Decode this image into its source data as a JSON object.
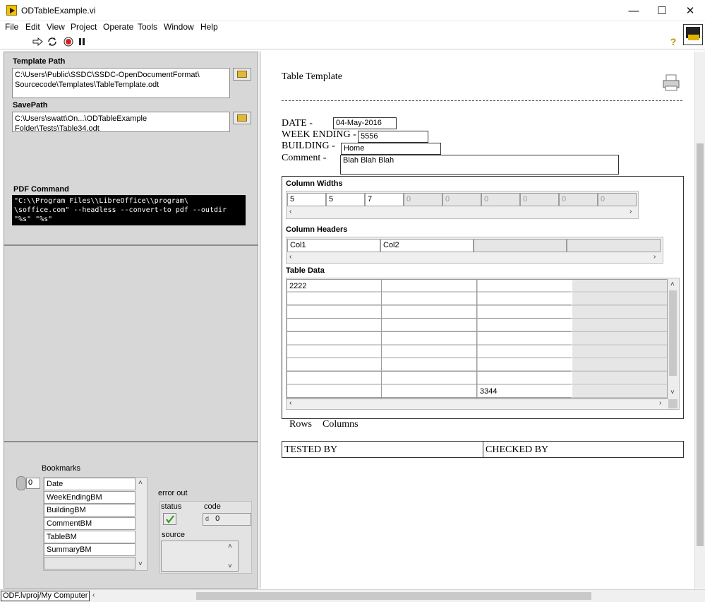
{
  "window": {
    "title": "ODTableExample.vi",
    "minimize": "—",
    "maximize": "☐",
    "close": "✕"
  },
  "menu": [
    "File",
    "Edit",
    "View",
    "Project",
    "Operate",
    "Tools",
    "Window",
    "Help"
  ],
  "toolbar": {
    "help_glyph": "?"
  },
  "left": {
    "template_path_label": "Template Path",
    "template_path_value": "C:\\Users\\Public\\SSDC\\SSDC-OpenDocumentFormat\\\nSourcecode\\Templates\\TableTemplate.odt",
    "save_path_label": "SavePath",
    "save_path_value": "C:\\Users\\swatt\\On...\\ODTableExample Folder\\Tests\\Table34.odt",
    "pdf_command_label": "PDF Command",
    "pdf_command_value": "\"C:\\\\Program Files\\\\LibreOffice\\\\program\\\n\\soffice.com\" --headless --convert-to pdf --outdir\n\"%s\" \"%s\"",
    "bookmarks_label": "Bookmarks",
    "bookmarks_index": "0",
    "bookmarks": [
      "Date",
      "WeekEndingBM",
      "BuildingBM",
      "CommentBM",
      "TableBM",
      "SummaryBM"
    ],
    "error_out_label": "error out",
    "status_label": "status",
    "code_label": "code",
    "code_value": "0",
    "code_prefix": "d",
    "source_label": "source"
  },
  "doc": {
    "heading": "Table Template",
    "date_label": "DATE  -",
    "date_value": "04-May-2016",
    "week_label": "WEEK ENDING -",
    "week_value": "5556",
    "building_label": "BUILDING -",
    "building_value": "Home",
    "comment_label": "Comment -",
    "comment_value": "Blah Blah Blah",
    "column_widths_label": "Column Widths",
    "column_widths": [
      "5",
      "5",
      "7",
      "0",
      "0",
      "0",
      "0",
      "0",
      "0"
    ],
    "column_headers_label": "Column Headers",
    "column_headers": [
      "Col1",
      "Col2",
      "",
      ""
    ],
    "table_data_label": "Table Data",
    "table_first_cell": "2222",
    "table_last_cell": "3344",
    "rows_label": "Rows",
    "columns_label": "Columns",
    "tested_by": "TESTED BY",
    "checked_by": "CHECKED BY"
  },
  "status": {
    "project": "ODF.lvproj/My Computer"
  },
  "colors": {
    "accent": "#f2c100",
    "pane": "#d7d7d7",
    "command_bg": "#000000",
    "status_ok": "#2f9a1e"
  }
}
